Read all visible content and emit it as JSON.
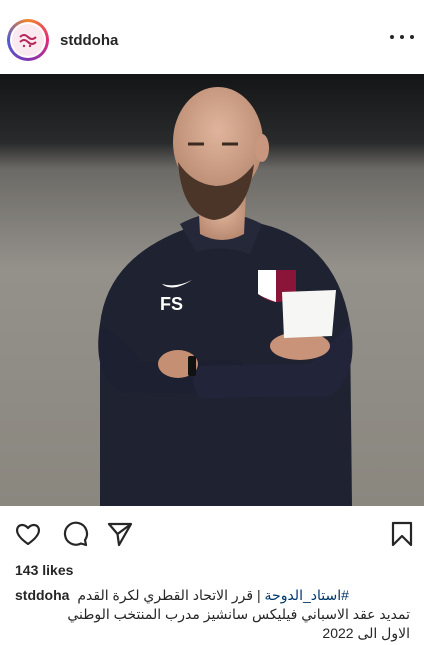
{
  "post": {
    "username": "stddoha",
    "likes": "143 likes",
    "caption": {
      "username": "stddoha",
      "hashtag": "#استاد_الدوحة",
      "line1_rest": " | قرر الاتحاد القطري لكرة القدم",
      "line2": "تمديد عقد الاسباني فيليكس سانشيز مدرب المنتخب الوطني",
      "line3": "الاول الى 2022"
    },
    "photo": {
      "jacket_initials": "FS"
    }
  },
  "icons": [
    "more-icon",
    "heart-icon",
    "comment-icon",
    "share-icon",
    "bookmark-icon"
  ],
  "colors": {
    "text": "#262626",
    "hashtag": "#00376b",
    "jacket": "#1f2230",
    "badge": "#8a1538"
  }
}
